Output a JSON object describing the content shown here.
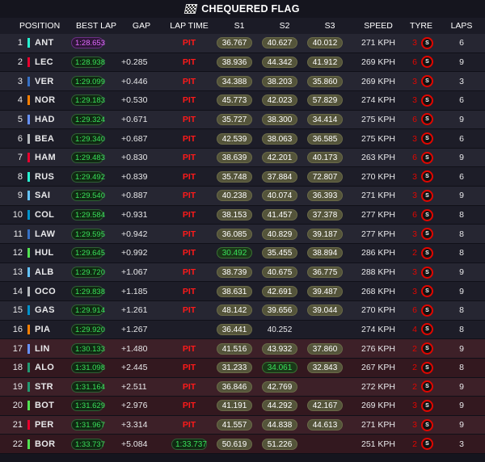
{
  "title": "CHEQUERED FLAG",
  "headers": {
    "position": "POSITION",
    "best_lap": "BEST LAP",
    "gap": "GAP",
    "lap_time": "LAP TIME",
    "s1": "S1",
    "s2": "S2",
    "s3": "S3",
    "speed": "SPEED",
    "tyre": "TYRE",
    "laps": "LAPS"
  },
  "colors": {
    "fastest_lap": "#e26bff",
    "personal_best": "#39e05a",
    "pit": "#ff1a1a",
    "tyre_soft": "#e10600"
  },
  "rows": [
    {
      "pos": "1",
      "driver": "ANT",
      "team_color": "#27f4d2",
      "best_lap": "1:28.653",
      "best_fastest": true,
      "gap": "",
      "lap_time": "PIT",
      "lap_time_is_pit": true,
      "s1": "36.767",
      "s2": "40.627",
      "s3": "40.012",
      "s1_style": "pill",
      "s2_style": "pill",
      "s3_style": "pill",
      "speed": "271 KPH",
      "tyre_age": "3",
      "tyre_compound": "S",
      "laps": "6",
      "retired": false
    },
    {
      "pos": "2",
      "driver": "LEC",
      "team_color": "#e8002d",
      "best_lap": "1:28.938",
      "best_fastest": false,
      "gap": "+0.285",
      "lap_time": "PIT",
      "lap_time_is_pit": true,
      "s1": "38.936",
      "s2": "44.342",
      "s3": "41.912",
      "s1_style": "pill",
      "s2_style": "pill",
      "s3_style": "pill",
      "speed": "269 KPH",
      "tyre_age": "6",
      "tyre_compound": "S",
      "laps": "9",
      "retired": false
    },
    {
      "pos": "3",
      "driver": "VER",
      "team_color": "#3671c6",
      "best_lap": "1:29.099",
      "best_fastest": false,
      "gap": "+0.446",
      "lap_time": "PIT",
      "lap_time_is_pit": true,
      "s1": "34.388",
      "s2": "38.203",
      "s3": "35.860",
      "s1_style": "pill",
      "s2_style": "pill",
      "s3_style": "pill",
      "speed": "269 KPH",
      "tyre_age": "3",
      "tyre_compound": "S",
      "laps": "3",
      "retired": false
    },
    {
      "pos": "4",
      "driver": "NOR",
      "team_color": "#ff8000",
      "best_lap": "1:29.183",
      "best_fastest": false,
      "gap": "+0.530",
      "lap_time": "PIT",
      "lap_time_is_pit": true,
      "s1": "45.773",
      "s2": "42.023",
      "s3": "57.829",
      "s1_style": "pill",
      "s2_style": "pill",
      "s3_style": "pill",
      "speed": "274 KPH",
      "tyre_age": "3",
      "tyre_compound": "S",
      "laps": "6",
      "retired": false
    },
    {
      "pos": "5",
      "driver": "HAD",
      "team_color": "#6692ff",
      "best_lap": "1:29.324",
      "best_fastest": false,
      "gap": "+0.671",
      "lap_time": "PIT",
      "lap_time_is_pit": true,
      "s1": "35.727",
      "s2": "38.300",
      "s3": "34.414",
      "s1_style": "pill",
      "s2_style": "pill",
      "s3_style": "pill",
      "speed": "275 KPH",
      "tyre_age": "6",
      "tyre_compound": "S",
      "laps": "9",
      "retired": false
    },
    {
      "pos": "6",
      "driver": "BEA",
      "team_color": "#b6babd",
      "best_lap": "1:29.340",
      "best_fastest": false,
      "gap": "+0.687",
      "lap_time": "PIT",
      "lap_time_is_pit": true,
      "s1": "42.539",
      "s2": "38.063",
      "s3": "36.585",
      "s1_style": "pill",
      "s2_style": "pill",
      "s3_style": "pill",
      "speed": "275 KPH",
      "tyre_age": "3",
      "tyre_compound": "S",
      "laps": "6",
      "retired": false
    },
    {
      "pos": "7",
      "driver": "HAM",
      "team_color": "#e8002d",
      "best_lap": "1:29.483",
      "best_fastest": false,
      "gap": "+0.830",
      "lap_time": "PIT",
      "lap_time_is_pit": true,
      "s1": "38.639",
      "s2": "42.201",
      "s3": "40.173",
      "s1_style": "pill",
      "s2_style": "pill",
      "s3_style": "pill",
      "speed": "263 KPH",
      "tyre_age": "6",
      "tyre_compound": "S",
      "laps": "9",
      "retired": false
    },
    {
      "pos": "8",
      "driver": "RUS",
      "team_color": "#27f4d2",
      "best_lap": "1:29.492",
      "best_fastest": false,
      "gap": "+0.839",
      "lap_time": "PIT",
      "lap_time_is_pit": true,
      "s1": "35.748",
      "s2": "37.884",
      "s3": "72.807",
      "s1_style": "pill",
      "s2_style": "pill",
      "s3_style": "pill",
      "speed": "270 KPH",
      "tyre_age": "3",
      "tyre_compound": "S",
      "laps": "6",
      "retired": false
    },
    {
      "pos": "9",
      "driver": "SAI",
      "team_color": "#64c4ff",
      "best_lap": "1:29.540",
      "best_fastest": false,
      "gap": "+0.887",
      "lap_time": "PIT",
      "lap_time_is_pit": true,
      "s1": "40.238",
      "s2": "40.074",
      "s3": "36.393",
      "s1_style": "pill",
      "s2_style": "pill",
      "s3_style": "pill",
      "speed": "271 KPH",
      "tyre_age": "3",
      "tyre_compound": "S",
      "laps": "9",
      "retired": false
    },
    {
      "pos": "10",
      "driver": "COL",
      "team_color": "#0093cc",
      "best_lap": "1:29.584",
      "best_fastest": false,
      "gap": "+0.931",
      "lap_time": "PIT",
      "lap_time_is_pit": true,
      "s1": "38.153",
      "s2": "41.457",
      "s3": "37.378",
      "s1_style": "pill",
      "s2_style": "pill",
      "s3_style": "pill",
      "speed": "277 KPH",
      "tyre_age": "6",
      "tyre_compound": "S",
      "laps": "8",
      "retired": false
    },
    {
      "pos": "11",
      "driver": "LAW",
      "team_color": "#3671c6",
      "best_lap": "1:29.595",
      "best_fastest": false,
      "gap": "+0.942",
      "lap_time": "PIT",
      "lap_time_is_pit": true,
      "s1": "36.085",
      "s2": "40.829",
      "s3": "39.187",
      "s1_style": "pill",
      "s2_style": "pill",
      "s3_style": "pill",
      "speed": "277 KPH",
      "tyre_age": "3",
      "tyre_compound": "S",
      "laps": "8",
      "retired": false
    },
    {
      "pos": "12",
      "driver": "HUL",
      "team_color": "#52e252",
      "best_lap": "1:29.645",
      "best_fastest": false,
      "gap": "+0.992",
      "lap_time": "PIT",
      "lap_time_is_pit": true,
      "s1": "30.492",
      "s2": "35.455",
      "s3": "38.894",
      "s1_style": "green",
      "s2_style": "pill",
      "s3_style": "pill",
      "speed": "286 KPH",
      "tyre_age": "2",
      "tyre_compound": "S",
      "laps": "8",
      "retired": false
    },
    {
      "pos": "13",
      "driver": "ALB",
      "team_color": "#64c4ff",
      "best_lap": "1:29.720",
      "best_fastest": false,
      "gap": "+1.067",
      "lap_time": "PIT",
      "lap_time_is_pit": true,
      "s1": "38.739",
      "s2": "40.675",
      "s3": "36.775",
      "s1_style": "pill",
      "s2_style": "pill",
      "s3_style": "pill",
      "speed": "288 KPH",
      "tyre_age": "3",
      "tyre_compound": "S",
      "laps": "9",
      "retired": false
    },
    {
      "pos": "14",
      "driver": "OCO",
      "team_color": "#b6babd",
      "best_lap": "1:29.838",
      "best_fastest": false,
      "gap": "+1.185",
      "lap_time": "PIT",
      "lap_time_is_pit": true,
      "s1": "38.631",
      "s2": "42.691",
      "s3": "39.487",
      "s1_style": "pill",
      "s2_style": "pill",
      "s3_style": "pill",
      "speed": "268 KPH",
      "tyre_age": "3",
      "tyre_compound": "S",
      "laps": "9",
      "retired": false
    },
    {
      "pos": "15",
      "driver": "GAS",
      "team_color": "#0093cc",
      "best_lap": "1:29.914",
      "best_fastest": false,
      "gap": "+1.261",
      "lap_time": "PIT",
      "lap_time_is_pit": true,
      "s1": "48.142",
      "s2": "39.656",
      "s3": "39.044",
      "s1_style": "pill",
      "s2_style": "pill",
      "s3_style": "pill",
      "speed": "270 KPH",
      "tyre_age": "6",
      "tyre_compound": "S",
      "laps": "8",
      "retired": false
    },
    {
      "pos": "16",
      "driver": "PIA",
      "team_color": "#ff8000",
      "best_lap": "1:29.920",
      "best_fastest": false,
      "gap": "+1.267",
      "lap_time": "",
      "lap_time_is_pit": false,
      "s1": "36.441",
      "s2": "40.252",
      "s3": "",
      "s1_style": "pill",
      "s2_style": "plain",
      "s3_style": "none",
      "speed": "274 KPH",
      "tyre_age": "4",
      "tyre_compound": "S",
      "laps": "8",
      "retired": false
    },
    {
      "pos": "17",
      "driver": "LIN",
      "team_color": "#6692ff",
      "best_lap": "1:30.133",
      "best_fastest": false,
      "gap": "+1.480",
      "lap_time": "PIT",
      "lap_time_is_pit": true,
      "s1": "41.516",
      "s2": "43.932",
      "s3": "37.860",
      "s1_style": "pill",
      "s2_style": "pill",
      "s3_style": "pill",
      "speed": "276 KPH",
      "tyre_age": "2",
      "tyre_compound": "S",
      "laps": "9",
      "retired": true
    },
    {
      "pos": "18",
      "driver": "ALO",
      "team_color": "#229971",
      "best_lap": "1:31.098",
      "best_fastest": false,
      "gap": "+2.445",
      "lap_time": "PIT",
      "lap_time_is_pit": true,
      "s1": "31.233",
      "s2": "34.061",
      "s3": "32.843",
      "s1_style": "pill",
      "s2_style": "green",
      "s3_style": "pill",
      "speed": "267 KPH",
      "tyre_age": "2",
      "tyre_compound": "S",
      "laps": "8",
      "retired": true
    },
    {
      "pos": "19",
      "driver": "STR",
      "team_color": "#229971",
      "best_lap": "1:31.164",
      "best_fastest": false,
      "gap": "+2.511",
      "lap_time": "PIT",
      "lap_time_is_pit": true,
      "s1": "36.846",
      "s2": "42.769",
      "s3": "",
      "s1_style": "pill",
      "s2_style": "pill",
      "s3_style": "none",
      "speed": "272 KPH",
      "tyre_age": "2",
      "tyre_compound": "S",
      "laps": "9",
      "retired": true
    },
    {
      "pos": "20",
      "driver": "BOT",
      "team_color": "#52e252",
      "best_lap": "1:31.629",
      "best_fastest": false,
      "gap": "+2.976",
      "lap_time": "PIT",
      "lap_time_is_pit": true,
      "s1": "41.191",
      "s2": "44.292",
      "s3": "42.167",
      "s1_style": "pill",
      "s2_style": "pill",
      "s3_style": "pill",
      "speed": "269 KPH",
      "tyre_age": "3",
      "tyre_compound": "S",
      "laps": "9",
      "retired": true
    },
    {
      "pos": "21",
      "driver": "PER",
      "team_color": "#e8002d",
      "best_lap": "1:31.967",
      "best_fastest": false,
      "gap": "+3.314",
      "lap_time": "PIT",
      "lap_time_is_pit": true,
      "s1": "41.557",
      "s2": "44.838",
      "s3": "44.613",
      "s1_style": "pill",
      "s2_style": "pill",
      "s3_style": "pill",
      "speed": "271 KPH",
      "tyre_age": "3",
      "tyre_compound": "S",
      "laps": "9",
      "retired": true
    },
    {
      "pos": "22",
      "driver": "BOR",
      "team_color": "#52e252",
      "best_lap": "1:33.737",
      "best_fastest": false,
      "gap": "+5.084",
      "lap_time": "1:33.737",
      "lap_time_is_pit": false,
      "s1": "50.619",
      "s2": "51.226",
      "s3": "",
      "s1_style": "pill",
      "s2_style": "pill",
      "s3_style": "none",
      "speed": "251 KPH",
      "tyre_age": "2",
      "tyre_compound": "S",
      "laps": "3",
      "retired": true
    }
  ]
}
